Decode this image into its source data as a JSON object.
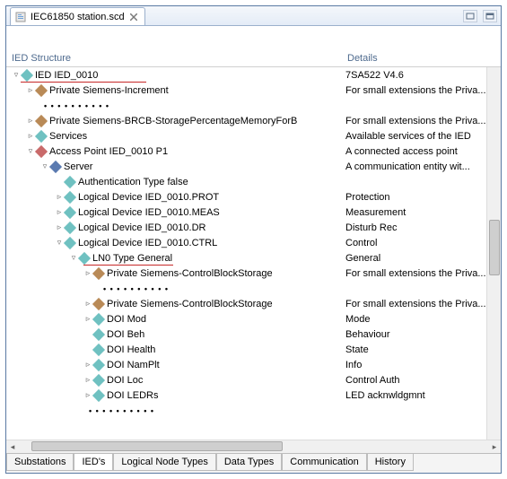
{
  "tab": {
    "title": "IEC61850 station.scd"
  },
  "headers": {
    "col1": "IED Structure",
    "col2": "Details"
  },
  "rows": [
    {
      "l": 1,
      "exp": "▿",
      "color": "#6fc1c1",
      "label": "IED IED_0010",
      "detail": "7SA522 V4.6",
      "uline": true
    },
    {
      "l": 2,
      "exp": "▹",
      "color": "#b98a57",
      "label": "Private Siemens-Increment",
      "detail": "For small extensions the Priva..."
    },
    {
      "dots": true,
      "dl": "d2"
    },
    {
      "l": 2,
      "exp": "▹",
      "color": "#b98a57",
      "label": "Private Siemens-BRCB-StoragePercentageMemoryForB",
      "detail": "For small extensions the Priva..."
    },
    {
      "l": 2,
      "exp": "▹",
      "color": "#6fc1c1",
      "label": "Services",
      "detail": "Available services of the IED"
    },
    {
      "l": 2,
      "exp": "▿",
      "color": "#c96a6a",
      "label": "Access Point  IED_0010 P1",
      "detail": "A connected access point"
    },
    {
      "l": 3,
      "exp": "▿",
      "color": "#5a7ab0",
      "label": "Server",
      "detail": "A communication  entity wit..."
    },
    {
      "l": 4,
      "exp": "",
      "color": "#6fc1c1",
      "label": "Authentication Type false",
      "detail": ""
    },
    {
      "l": 4,
      "exp": "▹",
      "color": "#6fc1c1",
      "label": "Logical Device IED_0010.PROT",
      "detail": "Protection"
    },
    {
      "l": 4,
      "exp": "▹",
      "color": "#6fc1c1",
      "label": "Logical Device IED_0010.MEAS",
      "detail": "Measurement"
    },
    {
      "l": 4,
      "exp": "▹",
      "color": "#6fc1c1",
      "label": "Logical Device IED_0010.DR",
      "detail": "Disturb Rec"
    },
    {
      "l": 4,
      "exp": "▿",
      "color": "#6fc1c1",
      "label": "Logical Device IED_0010.CTRL",
      "detail": "Control"
    },
    {
      "l": 5,
      "exp": "▿",
      "color": "#6fc1c1",
      "label": "LN0 Type General",
      "detail": "General",
      "uline": true
    },
    {
      "l": 6,
      "exp": "▹",
      "color": "#b98a57",
      "label": "Private Siemens-ControlBlockStorage",
      "detail": "For small extensions the Priva..."
    },
    {
      "dots": true,
      "dl": "d6"
    },
    {
      "l": 6,
      "exp": "▹",
      "color": "#b98a57",
      "label": "Private Siemens-ControlBlockStorage",
      "detail": "For small extensions the Priva..."
    },
    {
      "l": 6,
      "exp": "▹",
      "color": "#6fc1c1",
      "label": "DOI Mod",
      "detail": "Mode"
    },
    {
      "l": 6,
      "exp": "",
      "color": "#6fc1c1",
      "label": "DOI Beh",
      "detail": "Behaviour"
    },
    {
      "l": 6,
      "exp": "",
      "color": "#6fc1c1",
      "label": "DOI Health",
      "detail": "State"
    },
    {
      "l": 6,
      "exp": "▹",
      "color": "#6fc1c1",
      "label": "DOI NamPlt",
      "detail": "Info"
    },
    {
      "l": 6,
      "exp": "▹",
      "color": "#6fc1c1",
      "label": "DOI Loc",
      "detail": "Control Auth"
    },
    {
      "l": 6,
      "exp": "▹",
      "color": "#6fc1c1",
      "label": "DOI LEDRs",
      "detail": "LED acknwldgmnt"
    },
    {
      "dots": true,
      "dl": "d5"
    }
  ],
  "bottomTabs": {
    "items": [
      "Substations",
      "IED's",
      "Logical Node Types",
      "Data Types",
      "Communication",
      "History"
    ],
    "active": 1
  }
}
